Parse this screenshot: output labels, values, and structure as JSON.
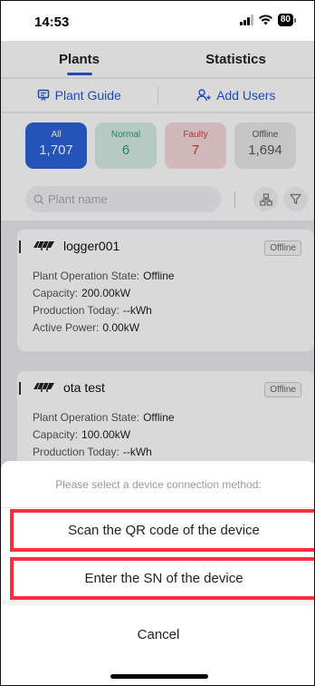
{
  "status_bar": {
    "time": "14:53",
    "battery": "80"
  },
  "tabs": [
    {
      "label": "Plants",
      "active": true
    },
    {
      "label": "Statistics",
      "active": false
    }
  ],
  "actions": {
    "plant_guide": "Plant Guide",
    "add_users": "Add Users"
  },
  "counts": [
    {
      "label": "All",
      "value": "1,707"
    },
    {
      "label": "Normal",
      "value": "6"
    },
    {
      "label": "Faulty",
      "value": "7"
    },
    {
      "label": "Offline",
      "value": "1,694"
    }
  ],
  "search": {
    "placeholder": "Plant name"
  },
  "plants": [
    {
      "name": "logger001",
      "status": "Offline",
      "rows": [
        {
          "label": "Plant Operation State:",
          "value": "Offline"
        },
        {
          "label": "Capacity:",
          "value": "200.00kW"
        },
        {
          "label": "Production Today:",
          "value": "--kWh"
        },
        {
          "label": "Active Power:",
          "value": "0.00kW"
        }
      ]
    },
    {
      "name": "ota test",
      "status": "Offline",
      "rows": [
        {
          "label": "Plant Operation State:",
          "value": "Offline"
        },
        {
          "label": "Capacity:",
          "value": "100.00kW"
        },
        {
          "label": "Production Today:",
          "value": "--kWh"
        }
      ]
    }
  ],
  "sheet": {
    "title": "Please select a device connection method:",
    "option_scan": "Scan the QR code of the device",
    "option_sn": "Enter the SN of the device",
    "cancel": "Cancel"
  },
  "colors": {
    "accent": "#2557d6",
    "highlight": "#ff2d3d"
  }
}
